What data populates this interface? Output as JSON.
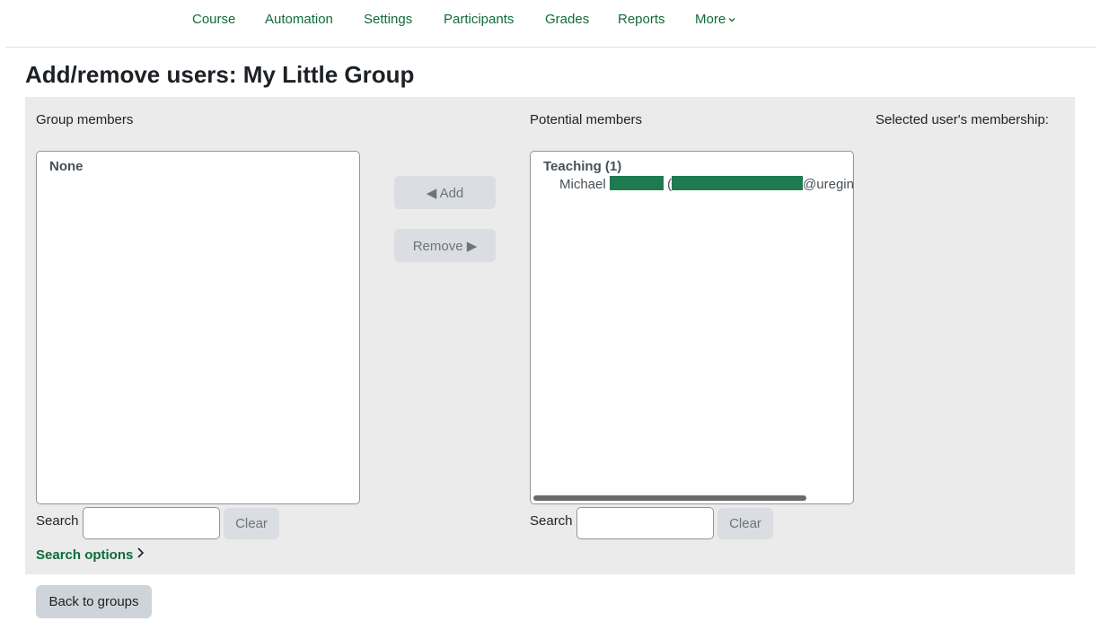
{
  "nav": {
    "items": [
      {
        "label": "Course"
      },
      {
        "label": "Automation"
      },
      {
        "label": "Settings"
      },
      {
        "label": "Participants"
      },
      {
        "label": "Grades"
      },
      {
        "label": "Reports"
      }
    ],
    "more_label": "More"
  },
  "page": {
    "title": "Add/remove users: My Little Group"
  },
  "group_members": {
    "heading": "Group members",
    "optgroup_label": "None",
    "search_label": "Search",
    "search_value": "",
    "clear_label": "Clear"
  },
  "actions": {
    "add_label": "◀ Add",
    "remove_label": "Remove ▶"
  },
  "potential_members": {
    "heading": "Potential members",
    "optgroup_label": "Teaching (1)",
    "user": {
      "first_name": "Michael",
      "paren_open": "(",
      "email_suffix": "@uregina"
    },
    "search_label": "Search",
    "search_value": "",
    "clear_label": "Clear"
  },
  "membership": {
    "heading": "Selected user's membership:"
  },
  "search_options": {
    "label": "Search options"
  },
  "footer": {
    "back_label": "Back to groups"
  },
  "colors": {
    "brand_green": "#0f6b3b",
    "redaction_green": "#1e7a4f",
    "panel_gray": "#ebebeb"
  }
}
